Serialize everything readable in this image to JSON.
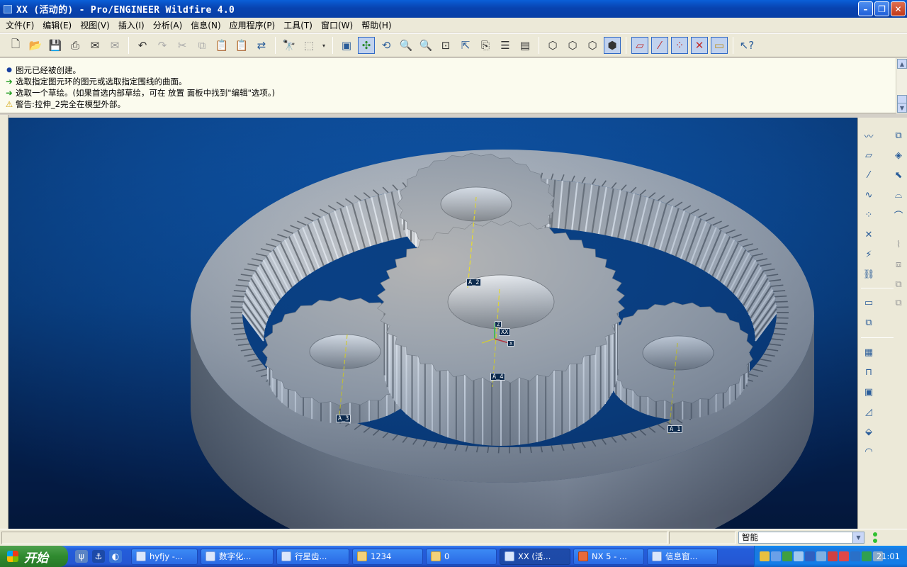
{
  "window": {
    "title": "XX (活动的) - Pro/ENGINEER Wildfire 4.0",
    "controls": [
      "minimize",
      "maximize",
      "close"
    ]
  },
  "menu": [
    "文件(F)",
    "编辑(E)",
    "视图(V)",
    "插入(I)",
    "分析(A)",
    "信息(N)",
    "应用程序(P)",
    "工具(T)",
    "窗口(W)",
    "帮助(H)"
  ],
  "toolbar_icons": [
    "new-file-icon",
    "open-file-icon",
    "save-icon",
    "print-icon",
    "send-mail-icon",
    "mail-recipient-icon",
    "undo-icon",
    "redo-icon",
    "cut-icon",
    "copy-icon",
    "paste-icon",
    "paste-special-icon",
    "regenerate-icon",
    "find-icon",
    "select-box-icon",
    "repaint-icon",
    "spin-center-icon",
    "orient-mode-icon",
    "zoom-in-icon",
    "zoom-out-icon",
    "refit-icon",
    "reorient-icon",
    "saved-views-icon",
    "layers-icon",
    "view-manager-icon",
    "wireframe-icon",
    "hidden-line-icon",
    "no-hidden-icon",
    "shading-icon",
    "datum-plane-display-icon",
    "datum-axis-display-icon",
    "datum-point-display-icon",
    "coord-sys-display-icon",
    "annotation-display-icon",
    "context-help-icon"
  ],
  "messages": [
    {
      "type": "info",
      "text": "图元已经被创建。"
    },
    {
      "type": "prompt",
      "text": "选取指定图元环的图元或选取指定围线的曲面。"
    },
    {
      "type": "prompt",
      "text": "选取一个草绘。(如果首选内部草绘，可在 放置 面板中找到\"编辑\"选项。)"
    },
    {
      "type": "warning",
      "text": "警告:拉伸_2完全在模型外部。"
    }
  ],
  "viewport": {
    "datum_tags": [
      "A_2",
      "A_4",
      "A_3",
      "A_1",
      "XX"
    ],
    "csys_axes": [
      "Z",
      "X"
    ]
  },
  "right_toolbar_icons": [
    "sketch-tool-icon",
    "datum-plane-icon",
    "datum-axis-icon",
    "datum-curve-icon",
    "datum-point-icon",
    "datum-offset-point-icon",
    "coord-system-icon",
    "analysis-feature-icon",
    "insert-mode-icon",
    "group-icon",
    "extrude-icon",
    "shell-icon",
    "draft-icon",
    "rib-icon",
    "round-icon",
    "chamfer-icon",
    "revolve-icon",
    "sweep-icon",
    "blend-icon",
    "boundary-blend-icon",
    "merge-icon",
    "trim-icon",
    "mirror-icon",
    "offset-icon",
    "pattern-icon"
  ],
  "status_bar": {
    "filter_value": "智能"
  },
  "taskbar": {
    "start_label": "开始",
    "tasks": [
      "hyfjy -...",
      "数字化...",
      "行星齿...",
      "1234",
      "0",
      "XX (活...",
      "NX 5 - ...",
      "信息窗..."
    ],
    "active_task_index": 5,
    "clock": "21:01"
  },
  "colors": {
    "title_blue": "#0a5fd8",
    "viewport_top": "#0f55a8",
    "viewport_bottom": "#041a40",
    "gear_gray": "#b9b9b9",
    "axis_yellow": "#f2e22a",
    "taskbar_blue": "#245edb",
    "start_green": "#2f8a2f"
  }
}
